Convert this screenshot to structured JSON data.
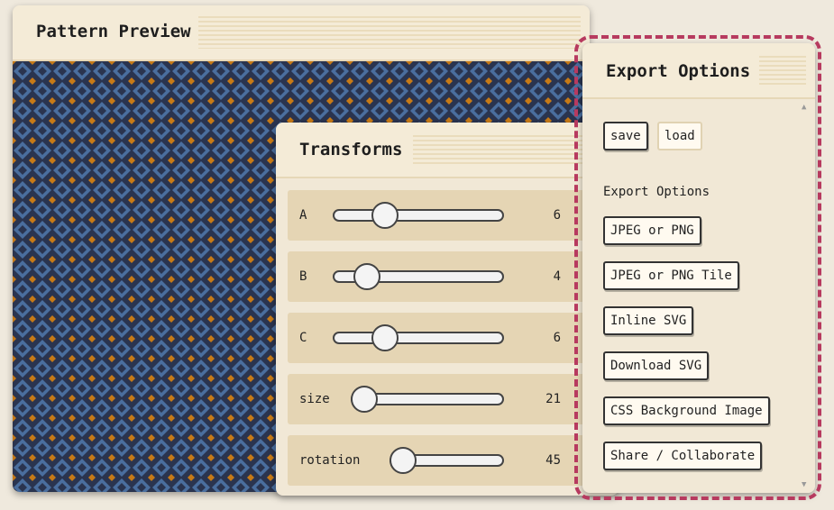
{
  "preview": {
    "title": "Pattern Preview"
  },
  "transforms": {
    "title": "Transforms",
    "sliders": [
      {
        "label": "A",
        "value": "6"
      },
      {
        "label": "B",
        "value": "4"
      },
      {
        "label": "C",
        "value": "6"
      },
      {
        "label": "size",
        "value": "21"
      },
      {
        "label": "rotation",
        "value": "45"
      }
    ]
  },
  "export": {
    "title": "Export Options",
    "save_label": "save",
    "load_label": "load",
    "section_label": "Export Options",
    "buttons": [
      "JPEG or PNG",
      "JPEG or PNG Tile",
      "Inline SVG",
      "Download SVG",
      "CSS Background Image",
      "Share / Collaborate"
    ]
  },
  "colors": {
    "pattern_background": "#2a344f",
    "pattern_diamond_blue": "#4a6e9e",
    "pattern_diamond_orange": "#c77a16",
    "highlight": "#b73a5f"
  },
  "icons": {
    "scroll_up": "▲",
    "scroll_down": "▼"
  }
}
